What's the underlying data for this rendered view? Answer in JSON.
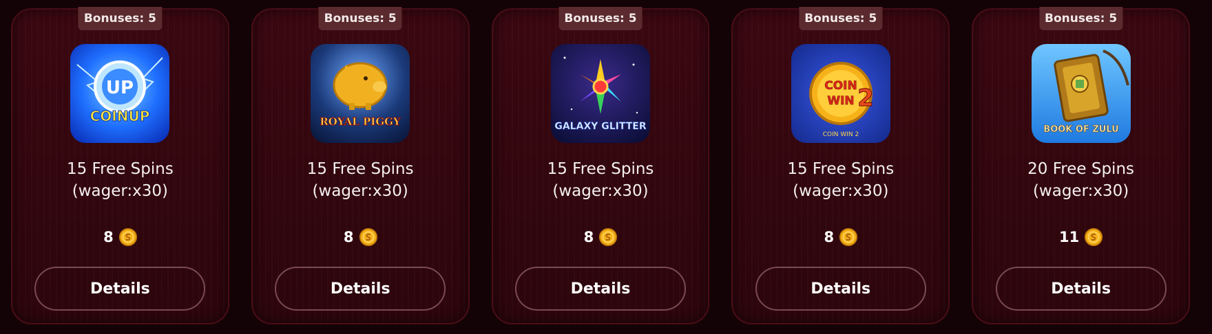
{
  "cards": [
    {
      "badge": "Bonuses: 5",
      "game_art_text": "COINUP",
      "title_line1": "15 Free Spins",
      "title_line2": "(wager:x30)",
      "price": "8",
      "details_label": "Details",
      "art_colors": [
        "#1f6fff",
        "#0a2fb8"
      ]
    },
    {
      "badge": "Bonuses: 5",
      "game_art_text": "ROYAL PIGGY",
      "title_line1": "15 Free Spins",
      "title_line2": "(wager:x30)",
      "price": "8",
      "details_label": "Details",
      "art_colors": [
        "#1b3a7a",
        "#f0b020"
      ]
    },
    {
      "badge": "Bonuses: 5",
      "game_art_text": "GALAXY GLITTER",
      "title_line1": "15 Free Spins",
      "title_line2": "(wager:x30)",
      "price": "8",
      "details_label": "Details",
      "art_colors": [
        "#0d0f3a",
        "#c0306a"
      ]
    },
    {
      "badge": "Bonuses: 5",
      "game_art_text": "COIN WIN 2",
      "title_line1": "15 Free Spins",
      "title_line2": "(wager:x30)",
      "price": "8",
      "details_label": "Details",
      "art_colors": [
        "#142a8c",
        "#e04a1a"
      ]
    },
    {
      "badge": "Bonuses: 5",
      "game_art_text": "BOOK OF ZULU",
      "title_line1": "20 Free Spins",
      "title_line2": "(wager:x30)",
      "price": "11",
      "details_label": "Details",
      "art_colors": [
        "#3aa6ff",
        "#d49b22"
      ]
    }
  ],
  "coin_icon": "gold-coin-icon",
  "colors": {
    "card_bg": "#3a0710",
    "card_border": "#4a0d17",
    "badge_bg": "#5a2a2e",
    "button_border": "#7a4b50",
    "coin_gold": "#f5b21a"
  }
}
